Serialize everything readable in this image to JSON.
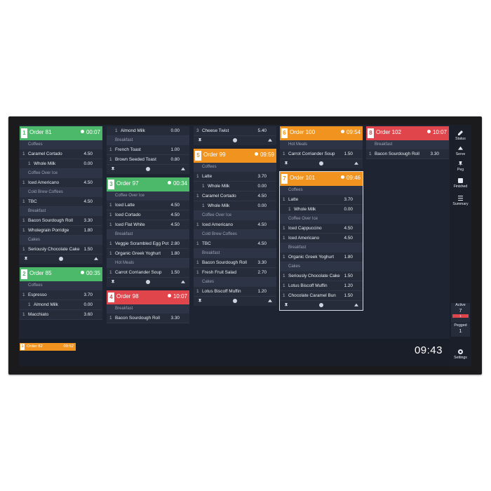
{
  "colors": {
    "green": "#4cb86a",
    "orange": "#f0931f",
    "red": "#e0454c",
    "panel": "#262c3a",
    "bg": "#1f2432"
  },
  "columns": [
    [
      {
        "num": "1",
        "title": "Order 81",
        "time": "00:07",
        "color": "green",
        "sections": [
          {
            "name": "Coffees",
            "items": [
              {
                "q": "1",
                "n": "Caramel Cortado",
                "p": "4.50"
              },
              {
                "q": "1",
                "n": "Whole Milk",
                "p": "0.00",
                "mod": true
              }
            ]
          },
          {
            "name": "Coffee Over Ice",
            "items": [
              {
                "q": "1",
                "n": "Iced Americano",
                "p": "4.50"
              }
            ]
          },
          {
            "name": "Cold Brew Coffees",
            "items": [
              {
                "q": "1",
                "n": "TBC",
                "p": "4.50"
              }
            ]
          },
          {
            "name": "Breakfast",
            "items": [
              {
                "q": "1",
                "n": "Bacon Sourdough Roll",
                "p": "3.30"
              },
              {
                "q": "1",
                "n": "Wholegrain Porridge",
                "p": "1.80"
              }
            ]
          },
          {
            "name": "Cakes",
            "items": [
              {
                "q": "1",
                "n": "Seriously Chocolate Cake",
                "p": "1.50"
              }
            ]
          }
        ],
        "footer": true
      },
      {
        "num": "2",
        "title": "Order 85",
        "time": "00:35",
        "color": "green",
        "sections": [
          {
            "name": "Coffees",
            "items": [
              {
                "q": "1",
                "n": "Espresso",
                "p": "3.70"
              },
              {
                "q": "1",
                "n": "Almond Milk",
                "p": "0.00",
                "mod": true
              },
              {
                "q": "1",
                "n": "Macchiato",
                "p": "3.60"
              }
            ]
          }
        ],
        "footer": false
      }
    ],
    [
      {
        "header": false,
        "sections": [
          {
            "name": "",
            "items": [
              {
                "q": "1",
                "n": "Almond Milk",
                "p": "0.00",
                "mod": true
              }
            ]
          },
          {
            "name": "Breakfast",
            "items": [
              {
                "q": "1",
                "n": "French Toast",
                "p": "1.00"
              },
              {
                "q": "1",
                "n": "Brown Seeded Toast",
                "p": "0.80"
              }
            ]
          }
        ],
        "footer": true
      },
      {
        "num": "3",
        "title": "Order 97",
        "time": "00:34",
        "color": "green",
        "sections": [
          {
            "name": "Coffee Over Ice",
            "items": [
              {
                "q": "1",
                "n": "Iced Latte",
                "p": "4.50"
              },
              {
                "q": "1",
                "n": "Iced Cortado",
                "p": "4.50"
              },
              {
                "q": "1",
                "n": "Iced Flat White",
                "p": "4.50"
              }
            ]
          },
          {
            "name": "Breakfast",
            "items": [
              {
                "q": "1",
                "n": "Veggie Scrambled Egg Pot",
                "p": "2.80"
              },
              {
                "q": "1",
                "n": "Organic Greek Yoghurt",
                "p": "1.80"
              }
            ]
          },
          {
            "name": "Hot Meals",
            "items": [
              {
                "q": "1",
                "n": "Carrot Corriander Soup",
                "p": "1.50"
              }
            ]
          }
        ],
        "footer": true
      },
      {
        "num": "4",
        "title": "Order 98",
        "time": "10:07",
        "color": "red",
        "sections": [
          {
            "name": "Breakfast",
            "items": [
              {
                "q": "1",
                "n": "Bacon Sourdough Roll",
                "p": "3.30"
              }
            ]
          }
        ],
        "footer": false
      }
    ],
    [
      {
        "header": false,
        "sections": [
          {
            "name": "",
            "items": [
              {
                "q": "3",
                "n": "Cheese Twist",
                "p": "5.40"
              }
            ]
          }
        ],
        "footer": true
      },
      {
        "num": "5",
        "title": "Order 99",
        "time": "09:59",
        "color": "orange",
        "sections": [
          {
            "name": "Coffees",
            "items": [
              {
                "q": "1",
                "n": "Latte",
                "p": "3.70"
              },
              {
                "q": "1",
                "n": "Whole Milk",
                "p": "0.00",
                "mod": true
              },
              {
                "q": "1",
                "n": "Caramel Cortado",
                "p": "4.50"
              },
              {
                "q": "1",
                "n": "Whole Milk",
                "p": "0.00",
                "mod": true
              }
            ]
          },
          {
            "name": "Coffee Over Ice",
            "items": [
              {
                "q": "1",
                "n": "Iced Americano",
                "p": "4.50"
              }
            ]
          },
          {
            "name": "Cold Brew Coffees",
            "items": [
              {
                "q": "1",
                "n": "TBC",
                "p": "4.50"
              }
            ]
          },
          {
            "name": "Breakfast",
            "items": [
              {
                "q": "1",
                "n": "Bacon Sourdough Roll",
                "p": "3.30"
              },
              {
                "q": "1",
                "n": "Fresh Fruit Salad",
                "p": "2.70"
              }
            ]
          },
          {
            "name": "Cakes",
            "items": [
              {
                "q": "1",
                "n": "Lotus Biscoff Muffin",
                "p": "1.20"
              }
            ]
          }
        ],
        "footer": true
      }
    ],
    [
      {
        "num": "6",
        "title": "Order 100",
        "time": "09:54",
        "color": "orange",
        "sections": [
          {
            "name": "Hot Meals",
            "items": [
              {
                "q": "1",
                "n": "Carrot Corriander Soup",
                "p": "1.50"
              }
            ]
          }
        ],
        "footer": true
      },
      {
        "num": "7",
        "title": "Order 101",
        "time": "09:46",
        "color": "orange",
        "selected": true,
        "sections": [
          {
            "name": "Coffees",
            "items": [
              {
                "q": "1",
                "n": "Latte",
                "p": "3.70"
              },
              {
                "q": "1",
                "n": "Whole Milk",
                "p": "0.00",
                "mod": true
              }
            ]
          },
          {
            "name": "Coffee Over Ice",
            "items": [
              {
                "q": "1",
                "n": "Iced Cappuccino",
                "p": "4.50"
              },
              {
                "q": "1",
                "n": "Iced Americano",
                "p": "4.50"
              }
            ]
          },
          {
            "name": "Breakfast",
            "items": [
              {
                "q": "1",
                "n": "Organic Greek Yoghurt",
                "p": "1.80"
              }
            ]
          },
          {
            "name": "Cakes",
            "items": [
              {
                "q": "1",
                "n": "Seriously Chocolate Cake",
                "p": "1.50"
              },
              {
                "q": "1",
                "n": "Lotus Biscoff Muffin",
                "p": "1.20"
              },
              {
                "q": "1",
                "n": "Chocolate Caramel Bun",
                "p": "1.50"
              }
            ]
          }
        ],
        "footer": true
      }
    ],
    [
      {
        "num": "8",
        "title": "Order 102",
        "time": "10:07",
        "color": "red",
        "sections": [
          {
            "name": "Breakfast",
            "items": [
              {
                "q": "1",
                "n": "Bacon Sourdough Roll",
                "p": "3.30"
              }
            ]
          }
        ],
        "footer": false
      }
    ]
  ],
  "rail": {
    "status": "Status",
    "serve": "Serve",
    "peg": "Peg",
    "finished": "Finished",
    "summary": "Summary",
    "active_label": "Active",
    "active_value": "7",
    "active_badge": "1",
    "pegged_label": "Pegged",
    "pegged_value": "1",
    "settings": "Settings"
  },
  "bottom": {
    "mini_num": "1",
    "mini_title": "Order 82",
    "mini_time": "09:52",
    "clock": "09:43"
  }
}
